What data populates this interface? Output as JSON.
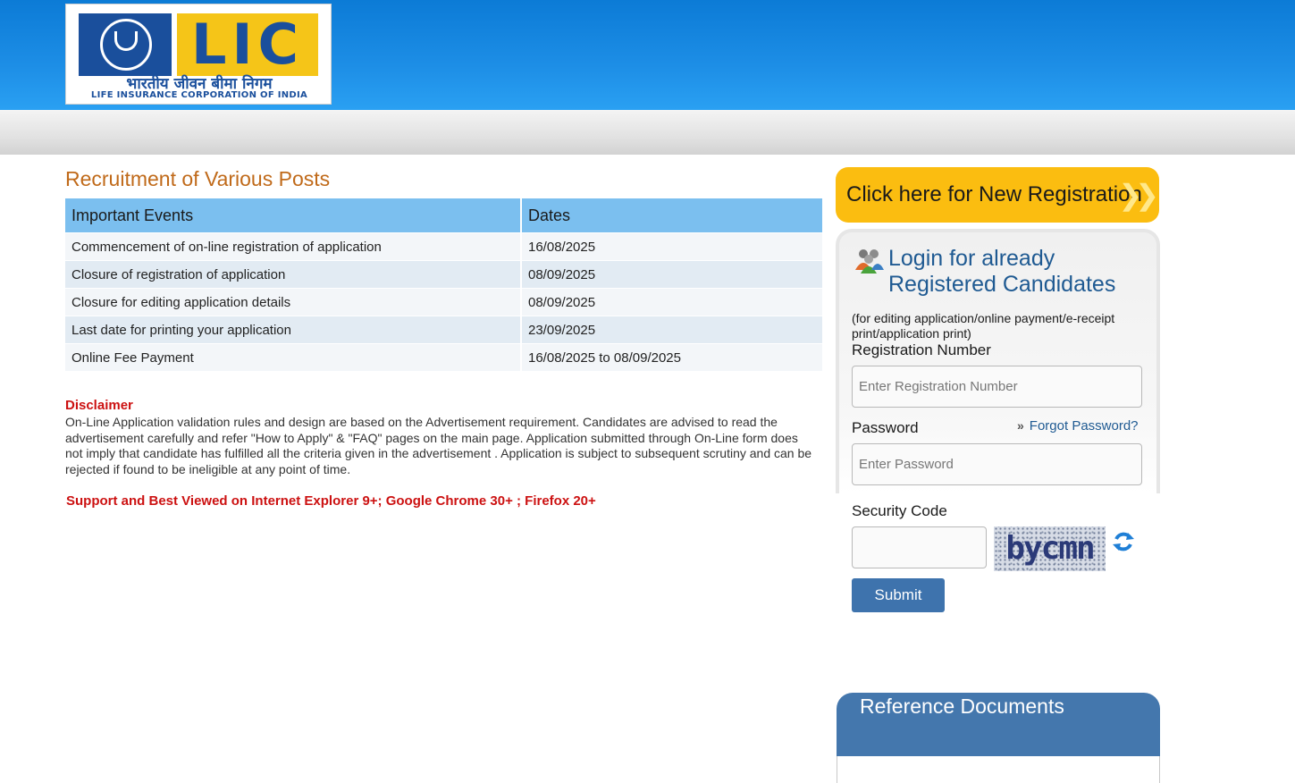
{
  "header": {
    "logo": {
      "brand": "LIC",
      "hindi_name": "भारतीय जीवन बीमा निगम",
      "english_name": "LIFE INSURANCE CORPORATION OF INDIA"
    },
    "colors": {
      "header_blue": "#1d8ee6",
      "logo_yellow": "#f5c518",
      "logo_blue": "#1a4f9c"
    }
  },
  "main": {
    "title": "Recruitment of Various Posts",
    "table": {
      "headers": [
        "Important Events",
        "Dates"
      ],
      "rows": [
        [
          "Commencement of on-line registration of application",
          "16/08/2025"
        ],
        [
          "Closure of registration of application",
          "08/09/2025"
        ],
        [
          "Closure for editing application details",
          "08/09/2025"
        ],
        [
          "Last date for printing your application",
          "23/09/2025"
        ],
        [
          "Online Fee Payment",
          "16/08/2025 to 08/09/2025"
        ]
      ]
    },
    "disclaimer": {
      "title": "Disclaimer",
      "text": "On-Line Application validation rules and design are based on the Advertisement requirement. Candidates are advised to read the advertisement carefully and refer \"How to Apply\" & \"FAQ\" pages on the main page. Application submitted through On-Line form does not imply that candidate has fulfilled all the criteria given in the advertisement . Application is subject to subsequent scrutiny and can be rejected if found to be ineligible at any point of time."
    },
    "support_note": "Support and Best Viewed on Internet Explorer 9+; Google Chrome 30+ ; Firefox 20+"
  },
  "sidebar": {
    "new_registration": "Click here for New Registration",
    "new_registration_icon": "double-chevron-right-icon",
    "login": {
      "icon": "users-icon",
      "title": "Login for already Registered Candidates",
      "subtitle": "(for editing application/online payment/e-receipt print/application print)",
      "registration_label": "Registration Number",
      "registration_placeholder": "Enter Registration Number",
      "registration_value": "",
      "password_label": "Password",
      "password_placeholder": "Enter Password",
      "password_value": "",
      "forgot_password": "Forgot Password?",
      "security_label": "Security Code",
      "security_value": "",
      "captcha_text": "bycmn",
      "refresh_icon": "refresh-icon",
      "submit": "Submit"
    },
    "reference_documents": "Reference Documents",
    "colors": {
      "accent_yellow": "#fbbd10",
      "button_blue": "#3e73ad",
      "panel_blue": "#4477ad"
    }
  }
}
